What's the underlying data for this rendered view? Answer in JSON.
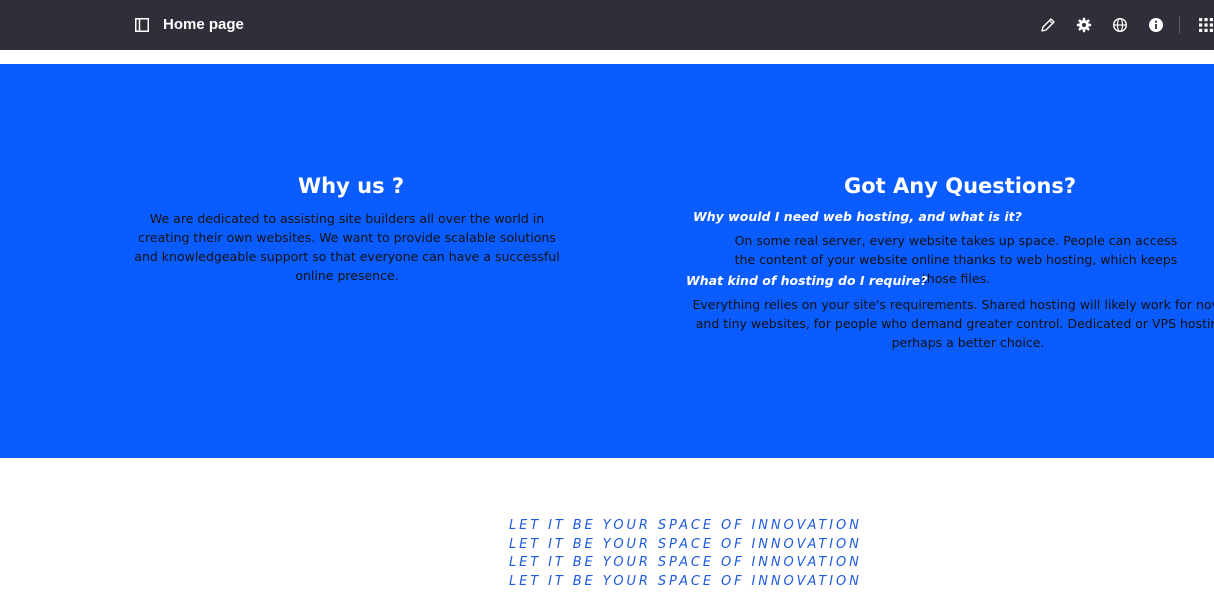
{
  "toolbar": {
    "title": "Home page",
    "icons": [
      "sidebar-panel-icon",
      "pencil-icon",
      "gear-icon",
      "globe-icon",
      "info-icon",
      "apps-grid-icon"
    ]
  },
  "hero": {
    "background": "#0b5cff",
    "why": {
      "title": "Why us ?",
      "text": "We are dedicated to assisting site builders all over the world in creating their own websites. We want to provide scalable solutions and knowledgeable support so that everyone can have a successful online presence."
    },
    "faq": {
      "title": "Got  Any Questions?",
      "items": [
        {
          "question": "Why would I need web hosting, and what is it?",
          "answer": "On some real server, every website takes up space. People can access the content of your website online thanks to web hosting, which keeps those files."
        },
        {
          "question": "What kind of hosting do I require?",
          "answer": "Everything relies on your site's requirements. Shared hosting will likely work for novices and tiny websites, for people who demand greater control. Dedicated or VPS hosting is perhaps a better choice."
        }
      ]
    }
  },
  "taglines": [
    "LET  IT BE YOUR SPACE OF INNOVATION",
    "LET  IT BE YOUR SPACE OF INNOVATION",
    "LET  IT BE YOUR SPACE OF INNOVATION",
    "LET  IT BE YOUR SPACE OF INNOVATION"
  ],
  "colors": {
    "topbar": "#2e2f38",
    "accent": "#0b5cff",
    "tagline": "#1e5be0"
  }
}
